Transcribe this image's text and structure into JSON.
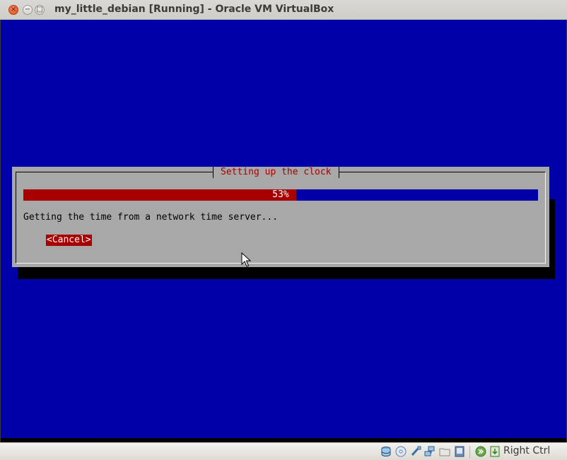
{
  "window": {
    "title": "my_little_debian [Running] - Oracle VM VirtualBox",
    "close_glyph": "×",
    "minimize_glyph": "−",
    "maximize_glyph": "□"
  },
  "installer": {
    "dialog_title": "Setting up the clock",
    "progress_percent": 53,
    "progress_label": "53%",
    "message": "Getting the time from a network time server...",
    "cancel_label": "<Cancel>"
  },
  "statusbar": {
    "icons": [
      "hard-disk-icon",
      "optical-drive-icon",
      "usb-icon",
      "network-icon",
      "shared-folders-icon",
      "video-capture-icon",
      "capture-icon",
      "keyboard-icon"
    ],
    "host_key": "Right Ctrl"
  },
  "colors": {
    "screen_background": "#0000a8",
    "dialog_background": "#a8a8a8",
    "accent_red": "#a80000"
  }
}
